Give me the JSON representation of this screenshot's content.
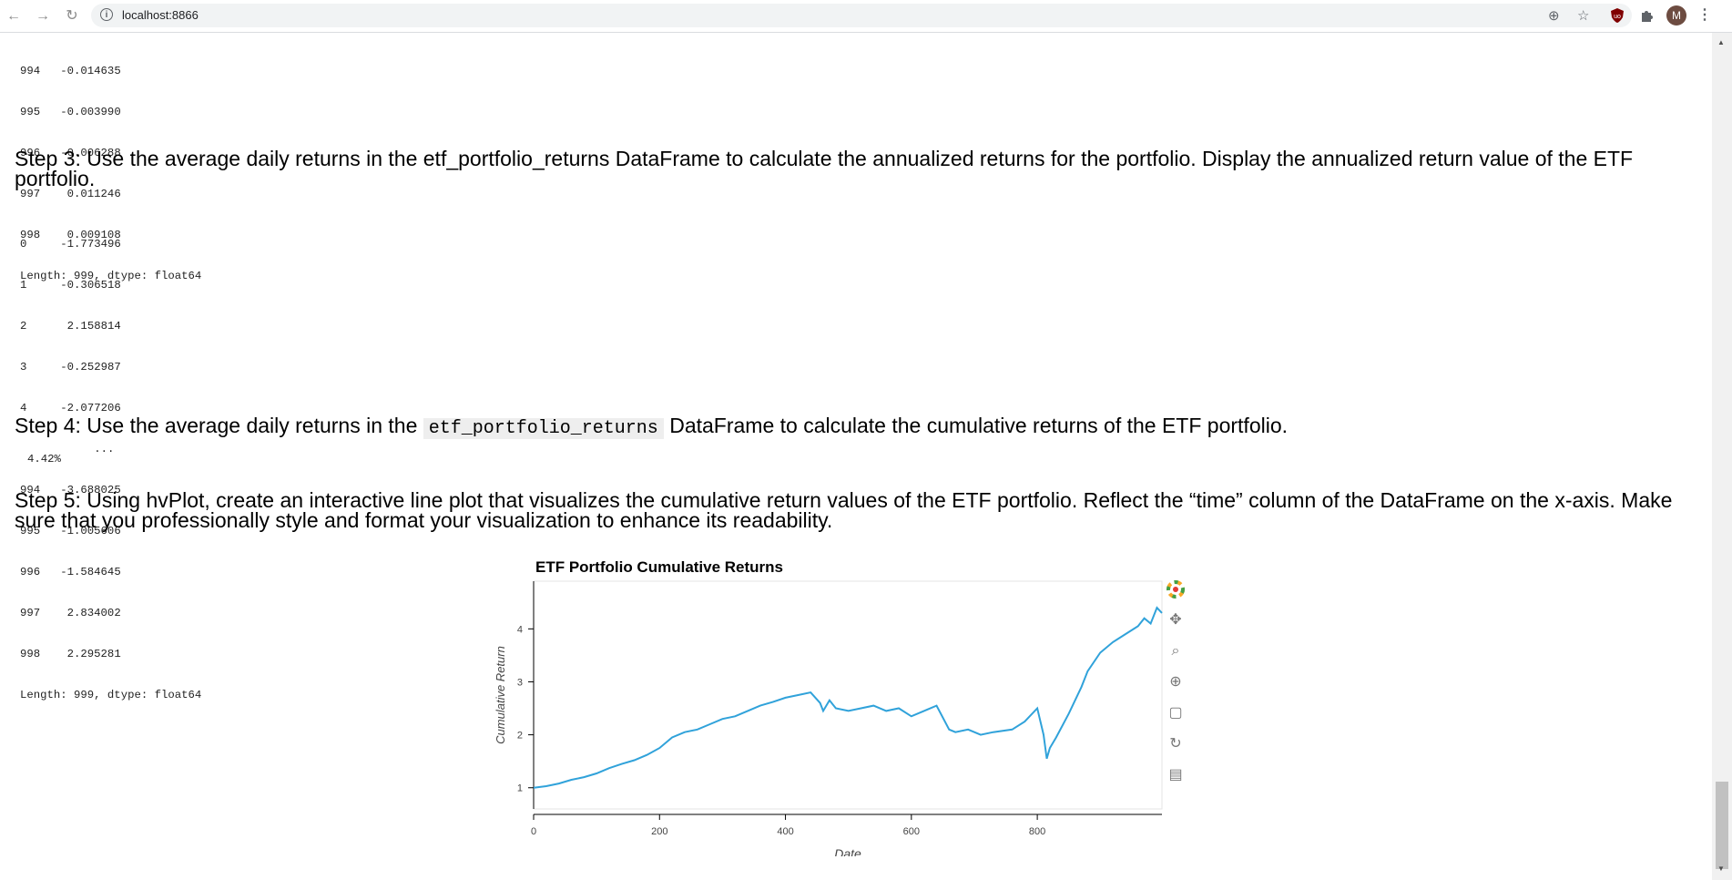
{
  "browser": {
    "url": "localhost:8866",
    "avatar_letter": "M",
    "icons": [
      "back-icon",
      "forward-icon",
      "reload-icon",
      "info-icon",
      "zoom-icon",
      "star-icon",
      "ublock-icon",
      "extensions-icon",
      "menu-icon"
    ]
  },
  "output1": {
    "rows": [
      {
        "index": "994",
        "value": "-0.014635"
      },
      {
        "index": "995",
        "value": "-0.003990"
      },
      {
        "index": "996",
        "value": "-0.006288"
      },
      {
        "index": "997",
        "value": " 0.011246"
      },
      {
        "index": "998",
        "value": " 0.009108"
      }
    ],
    "length_line": "Length: 999, dtype: float64"
  },
  "step3": {
    "text": "Step 3: Use the average daily returns in the etf_portfolio_returns DataFrame to calculate the annualized returns for the portfolio. Display the annualized return value of the ETF portfolio."
  },
  "output2": {
    "rows_top": [
      {
        "index": "0",
        "value": "-1.773496"
      },
      {
        "index": "1",
        "value": "-0.306518"
      },
      {
        "index": "2",
        "value": " 2.158814"
      },
      {
        "index": "3",
        "value": "-0.252987"
      },
      {
        "index": "4",
        "value": "-2.077206"
      }
    ],
    "ellipsis": "...",
    "rows_bottom": [
      {
        "index": "994",
        "value": "-3.688025"
      },
      {
        "index": "995",
        "value": "-1.005606"
      },
      {
        "index": "996",
        "value": "-1.584645"
      },
      {
        "index": "997",
        "value": " 2.834002"
      },
      {
        "index": "998",
        "value": " 2.295281"
      }
    ],
    "length_line": "Length: 999, dtype: float64"
  },
  "step4": {
    "prefix": "Step 4: Use the average daily returns in the",
    "code": "etf_portfolio_returns",
    "suffix": "DataFrame to calculate the cumulative returns of the ETF portfolio."
  },
  "output3": {
    "value": "4.42%"
  },
  "step5": {
    "text": "Step 5: Using hvPlot, create an interactive line plot that visualizes the cumulative return values of the ETF portfolio. Reflect the “time” column of the DataFrame on the x-axis. Make sure that you professionally style and format your visualization to enhance its readability."
  },
  "chart_data": {
    "type": "line",
    "title": "ETF Portfolio Cumulative Returns",
    "xlabel": "Date",
    "ylabel": "Cumulative Return",
    "xlim": [
      0,
      998
    ],
    "ylim": [
      0.6,
      4.9
    ],
    "xticks": [
      "0",
      "200",
      "400",
      "600",
      "800"
    ],
    "yticks": [
      "1",
      "2",
      "3",
      "4"
    ],
    "line_color": "#30a2da",
    "series": [
      {
        "x": [
          0,
          20,
          40,
          60,
          80,
          100,
          120,
          140,
          160,
          180,
          200,
          220,
          240,
          260,
          280,
          300,
          320,
          340,
          360,
          380,
          400,
          420,
          440,
          455,
          460,
          470,
          480,
          500,
          520,
          540,
          560,
          580,
          600,
          620,
          640,
          660,
          670,
          690,
          710,
          730,
          760,
          780,
          800,
          810,
          815,
          820,
          830,
          850,
          870,
          880,
          900,
          920,
          940,
          960,
          970,
          980,
          990,
          998
        ],
        "y": [
          1.0,
          1.03,
          1.08,
          1.15,
          1.2,
          1.27,
          1.37,
          1.45,
          1.52,
          1.62,
          1.75,
          1.95,
          2.05,
          2.1,
          2.2,
          2.3,
          2.35,
          2.45,
          2.55,
          2.62,
          2.7,
          2.75,
          2.8,
          2.6,
          2.45,
          2.65,
          2.5,
          2.45,
          2.5,
          2.55,
          2.45,
          2.5,
          2.35,
          2.45,
          2.55,
          2.1,
          2.05,
          2.1,
          2.0,
          2.05,
          2.1,
          2.25,
          2.5,
          2.0,
          1.55,
          1.75,
          1.95,
          2.4,
          2.9,
          3.2,
          3.55,
          3.75,
          3.9,
          4.05,
          4.2,
          4.1,
          4.4,
          4.3
        ]
      }
    ]
  }
}
